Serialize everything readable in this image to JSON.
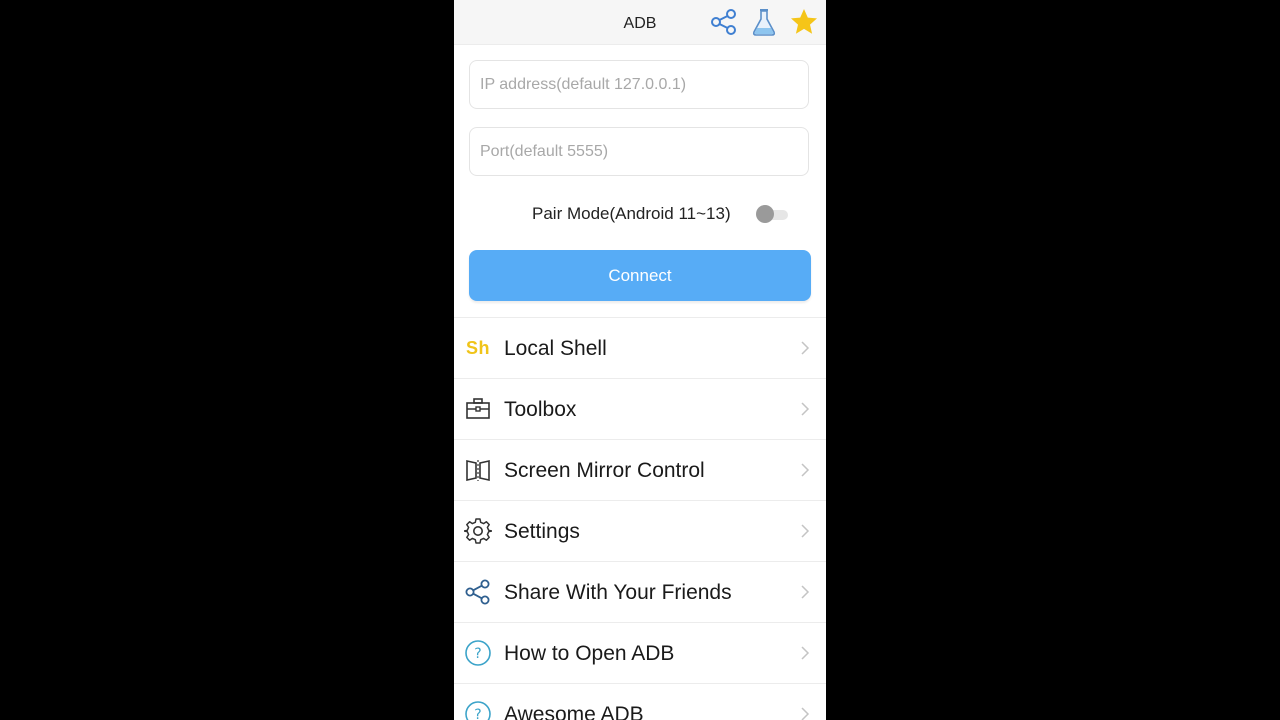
{
  "appbar": {
    "title": "ADB",
    "icons": [
      "share-icon",
      "flask-icon",
      "star-icon"
    ],
    "star_color": "#f5c518",
    "accent_color": "#3f7fd1"
  },
  "form": {
    "ip_placeholder": "IP address(default 127.0.0.1)",
    "ip_value": "",
    "port_placeholder": "Port(default 5555)",
    "port_value": "",
    "pair_mode_label": "Pair Mode(Android 11~13)",
    "pair_mode_on": false,
    "connect_label": "Connect",
    "connect_color": "#57acf6"
  },
  "menu": {
    "items": [
      {
        "label": "Local Shell",
        "icon": "sh-icon",
        "icon_text": "Sh"
      },
      {
        "label": "Toolbox",
        "icon": "toolbox-icon"
      },
      {
        "label": "Screen Mirror Control",
        "icon": "mirror-icon"
      },
      {
        "label": "Settings",
        "icon": "gear-icon"
      },
      {
        "label": "Share With Your Friends",
        "icon": "share-icon"
      },
      {
        "label": "How to Open ADB",
        "icon": "help-icon"
      },
      {
        "label": "Awesome ADB",
        "icon": "help-icon"
      }
    ]
  }
}
